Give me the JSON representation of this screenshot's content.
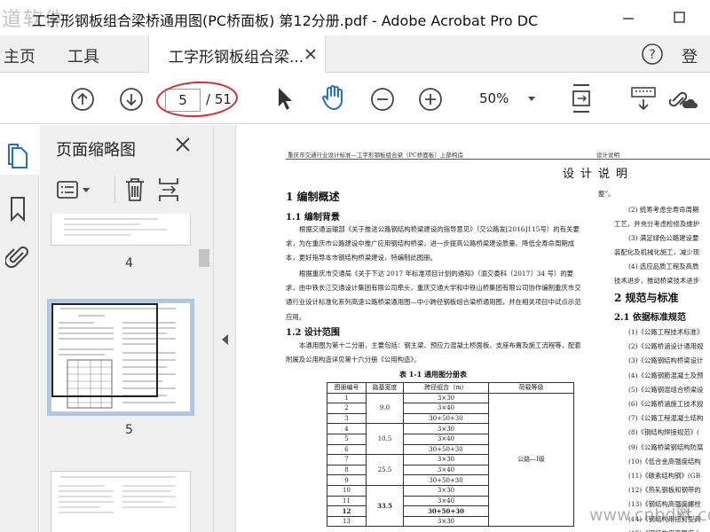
{
  "window": {
    "title": "工字形钢板组合梁桥通用图(PC桥面板) 第12分册.pdf - Adobe Acrobat Pro DC",
    "watermark_tl": "道软件",
    "watermark_br": "www.cnbdxt.com",
    "watermark_br_logo": "网"
  },
  "menu": {
    "home": "主页",
    "tools": "工具",
    "doc_tab": "工字形钢板组合梁...",
    "signin": "登"
  },
  "toolbar": {
    "current_page": "5",
    "total_pages": "/ 51",
    "zoom": "50%"
  },
  "thumbnails": {
    "title": "页面缩略图",
    "pages": [
      {
        "num": "4"
      },
      {
        "num": "5"
      }
    ]
  },
  "document": {
    "header_left": "重庆市交通行业设计标准—工字形钢板组合梁（PC桥面板）上部构造",
    "header_right": "设计说明",
    "title": "设计说明",
    "s1": "1 编制概述",
    "s1_1": "1.1 编制背景",
    "p1": "根据交通运输部《关于推进公路钢结构桥梁建设的指导意见》（交公路发[2016]115号）的有关要求，为在重庆市公路建设中推广应用钢结构桥梁，进一步提高公路桥梁建设质量、降低全寿命周期成本，更好指导本市钢结构桥梁建设，特编制此图册。",
    "p2": "根据重庆市交通局《关于下达 2017 年标准项目计划的通知》（渝交委科〔2017〕34 号）的要求，由中铁长江交通设计集团有限公司牵头，重庆交通大学和中铁山桥集团有限公司协作编制重庆市交通行业设计标准化系列高速公路桥梁通用图—中小跨径钢板组合梁桥通用图，并在相关项目中试点示范应用。",
    "s1_2": "1.2 设计范围",
    "p3": "本通用图为第十二分册，主要包括：钢主梁、预应力混凝土桥面板、支座布置及施工流程等，配套附属及公用构造详见第十六分册《公用构造》。",
    "right_frag": "整”。",
    "right_lines": [
      "(2) 统筹考虑全寿命周期",
      "工艺，并充分考虑检修及维护",
      "(3) 满足绿色公路建设要",
      "装配化及机械化施工，减少现",
      "(4) 选应品质工程及高质",
      "技术进步，推动桥梁技术进步"
    ],
    "s2": "2 规范与标准",
    "s2_1": "2.1 依据标准规范",
    "std_list": [
      "(1)《公路工程技术标准》",
      "(2)《公路桥涵设计通用规",
      "(3)《公路钢结构桥梁设计",
      "(4)《公路钢筋混凝土及预",
      "(5)《公路钢混组合桥梁设",
      "(6)《公路桥涵施工技术规",
      "(7)《公路工程混凝土结构",
      "(8)《钢结构焊接规范》(",
      "(9)《公路桥梁钢结构防腐",
      "(10)《低合金高强度结构",
      "(11)《碳素结构钢》(GB",
      "(12)《热轧钢板和钢带的",
      "(13)《钢结构高强度螺栓",
      "(14)《钢结构用扭剪型高",
      "(15)《钢结构用高强度大"
    ],
    "table": {
      "caption": "表 1-1  通用图分册表",
      "headers": [
        "图册编号",
        "路基宽度",
        "跨径组合（m）",
        "荷载等级"
      ],
      "load_class": "公路—Ⅰ级",
      "rows": [
        {
          "no": "1",
          "width": "9.0",
          "span": "3×30"
        },
        {
          "no": "2",
          "width": "",
          "span": "3×40"
        },
        {
          "no": "3",
          "width": "",
          "span": "30+50+30"
        },
        {
          "no": "4",
          "width": "10.5",
          "span": "3×30"
        },
        {
          "no": "5",
          "width": "",
          "span": "3×40"
        },
        {
          "no": "6",
          "width": "",
          "span": "30+50+30"
        },
        {
          "no": "7",
          "width": "25.5",
          "span": "3×30"
        },
        {
          "no": "8",
          "width": "",
          "span": "3×40"
        },
        {
          "no": "9",
          "width": "",
          "span": "30+50+30"
        },
        {
          "no": "10",
          "width": "33.5",
          "span": "3×30"
        },
        {
          "no": "11",
          "width": "",
          "span": "3×40"
        },
        {
          "no": "12",
          "width": "",
          "span": "30+50+30"
        },
        {
          "no": "13",
          "width": "",
          "span": "3×30"
        }
      ]
    }
  }
}
